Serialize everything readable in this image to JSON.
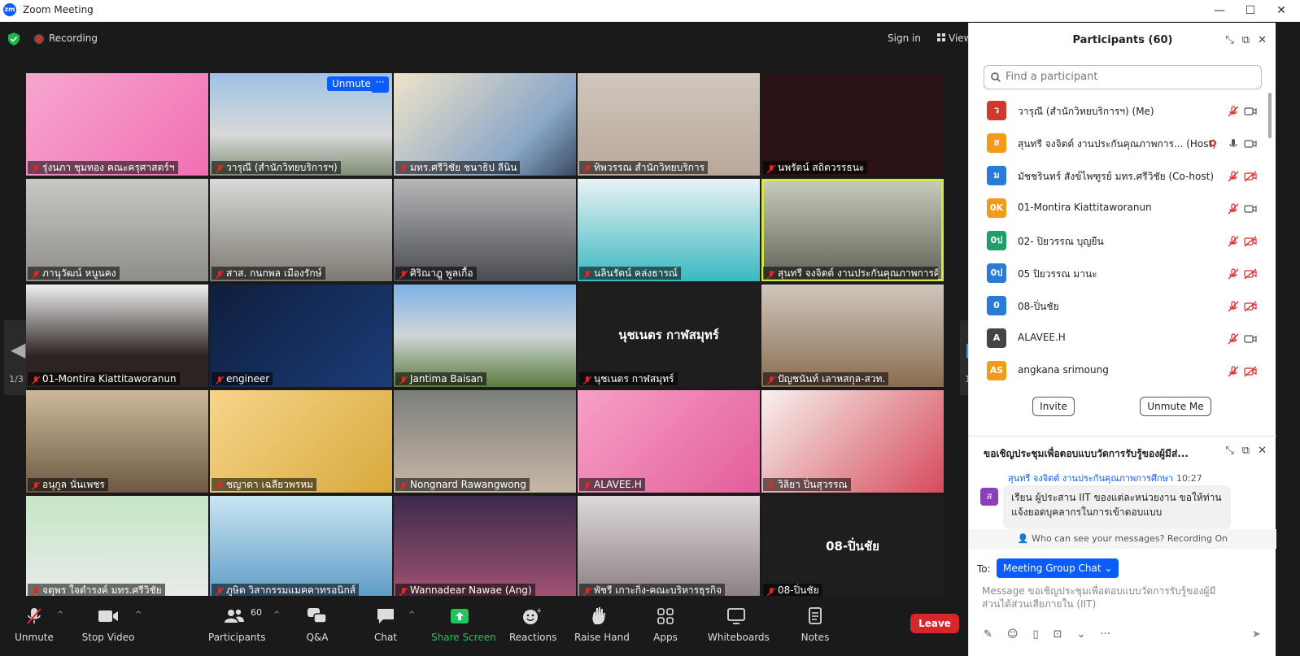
{
  "window": {
    "title": "Zoom Meeting",
    "logo": "zm",
    "minimize": "—",
    "maximize": "☐",
    "close": "✕"
  },
  "topbar": {
    "recording": "Recording",
    "signin": "Sign in",
    "view": "View"
  },
  "tile_overlay": {
    "unmute": "Unmute",
    "more": "···"
  },
  "nav": {
    "page_left": "1/3",
    "page_right": "1/3",
    "left_arrow": "◀",
    "right_arrow": "▶"
  },
  "tiles": [
    {
      "name": "รุ่งนภา ชุมทอง คณะครุศาสตร์ฯ",
      "bg": "linear-gradient(135deg,#f7a6cf,#f06fb3)"
    },
    {
      "name": "วารุณี (สำนักวิทยบริการฯ)",
      "bg": "linear-gradient(180deg,#9fc1e6,#d9d9d9 60%,#7f8e77)"
    },
    {
      "name": "มทร.ศรีวิชัย ชนาธิป ลีนิน",
      "bg": "linear-gradient(135deg,#efe3c9,#8aa7c8 70%,#394b63)"
    },
    {
      "name": "ทิพวรรณ สำนักวิทยบริการ",
      "bg": "linear-gradient(180deg,#cfc7bd,#b9a89a)"
    },
    {
      "name": "นพรัตน์ สถิตวรรธนะ",
      "bg": "#2a1216"
    },
    {
      "name": "ภานุวัฒน์ หนูนคง",
      "bg": "linear-gradient(180deg,#c9c8c4,#8f8d88)"
    },
    {
      "name": "สาส. กนกพล เมืองรักษ์",
      "bg": "linear-gradient(180deg,#d9d9d7,#7e7a72)"
    },
    {
      "name": "ศิริณาฎู พูลเกื้อ",
      "bg": "linear-gradient(180deg,#b5b7b9,#4a4b4f)"
    },
    {
      "name": "นลินรัตน์ คล่งธารณ์",
      "bg": "linear-gradient(180deg,#e9f3f5,#3bb8c0)"
    },
    {
      "name": "สุนทรี จงจิตต์ งานประกันคุณภาพการศึกษา",
      "bg": "linear-gradient(180deg,#c9cdbd,#5f6255)"
    },
    {
      "name": "01-Montira Kiattitaworanun",
      "bg": "linear-gradient(180deg,#f0f0f0,#2d2320 70%)"
    },
    {
      "name": "engineer",
      "bg": "linear-gradient(135deg,#0e1e3d,#1c3c77)"
    },
    {
      "name": "Jantima Baisan",
      "bg": "linear-gradient(180deg,#7fb1e6,#cfd6d7 50%,#5a7b3e)"
    },
    {
      "name": "นุชเนตร กาฬสมุทร์",
      "bg": "#1e1e1e",
      "center": "นุชเนตร กาฬสมุทร์"
    },
    {
      "name": "ปัญชนันท์ เลาหสกุล-สวท.",
      "bg": "linear-gradient(180deg,#cfc7bd,#8a6c50)"
    },
    {
      "name": "อนุกูล นั่นเพชร",
      "bg": "linear-gradient(180deg,#cdb99a,#6e5a44)"
    },
    {
      "name": "ชญาดา เฉลียวพรหม",
      "bg": "linear-gradient(135deg,#f6d58a,#d8a93c)"
    },
    {
      "name": "Nongnard Rawangwong",
      "bg": "linear-gradient(180deg,#7a7f7a,#c8b7a8)"
    },
    {
      "name": "ALAVEE.H",
      "bg": "linear-gradient(135deg,#f6a1c6,#e35e99)"
    },
    {
      "name": "วิลิยา ปิ่นสุวรรณ",
      "bg": "linear-gradient(135deg,#f7f2ee,#d64a5b)"
    },
    {
      "name": "จตุพร ใจดำรงค์ มทร.ศรีวิชัย",
      "bg": "linear-gradient(180deg,#c5e6c5,#eaeaea)"
    },
    {
      "name": "ภูษิต วิสากรรมแมคคาทรอนิกส์",
      "bg": "linear-gradient(180deg,#c9e6f4,#5e9bc4)"
    },
    {
      "name": "Wannadear Nawae (Ang)",
      "bg": "linear-gradient(180deg,#3c2a4d,#a25372)"
    },
    {
      "name": "พัชรี เกาะกิ่ง-คณะบริหารธุรกิจ",
      "bg": "linear-gradient(180deg,#ded8d8,#8b7f82)"
    },
    {
      "name": "08-ปิ่นชัย",
      "bg": "#1e1e1e",
      "center": "08-ปิ่นชัย"
    }
  ],
  "toolbar": {
    "unmute": "Unmute",
    "stop_video": "Stop Video",
    "participants": "Participants",
    "participants_count": "60",
    "qa": "Q&A",
    "chat": "Chat",
    "share": "Share Screen",
    "reactions": "Reactions",
    "raise_hand": "Raise Hand",
    "apps": "Apps",
    "whiteboards": "Whiteboards",
    "notes": "Notes",
    "leave": "Leave"
  },
  "participants_panel": {
    "title": "Participants (60)",
    "search_placeholder": "Find a participant",
    "invite": "Invite",
    "unmute_me": "Unmute Me",
    "items": [
      {
        "initials": "ว",
        "color": "#d03a2e",
        "name": "วารุณี (สำนักวิทยบริการฯ) (Me)",
        "mic": "muted",
        "cam": "on"
      },
      {
        "initials": "ส",
        "color": "#f29a1a",
        "name": "สุนทรี จงจิตต์ งานประกันคุณภาพการ... (Host)",
        "mic": "on",
        "cam": "on",
        "rec": true
      },
      {
        "initials": "ม",
        "color": "#2a7bd6",
        "name": "มัชชรินทร์ สังข์ไพฑูรย์ มทร.ศรีวิชัย (Co-host)",
        "mic": "muted",
        "cam": "off"
      },
      {
        "initials": "0K",
        "color": "#f29a1a",
        "name": "01-Montira Kiattitaworanun",
        "mic": "muted",
        "cam": "on"
      },
      {
        "initials": "0ป",
        "color": "#1f9e68",
        "name": "02- ปิยวรรณ บุญยืน",
        "mic": "muted",
        "cam": "off"
      },
      {
        "initials": "0ป",
        "color": "#2a7bd6",
        "name": "05 ปิยวรรณ มานะ",
        "mic": "muted",
        "cam": "off"
      },
      {
        "initials": "0",
        "color": "#2a7bd6",
        "name": "08-ปิ่นชัย",
        "mic": "muted",
        "cam": "off"
      },
      {
        "initials": "A",
        "color": "#444444",
        "name": "ALAVEE.H",
        "mic": "muted",
        "cam": "on"
      },
      {
        "initials": "AS",
        "color": "#f29a1a",
        "name": "angkana srimoung",
        "mic": "muted",
        "cam": "off"
      }
    ]
  },
  "chat_panel": {
    "title": "ขอเชิญประชุมเพื่อตอบแบบวัดการรับรู้ของผู้มีส่...",
    "sender": "สุนทรี จงจิตต์ งานประกันคุณภาพการศึกษา",
    "time": "10:27",
    "avatar": "ส",
    "message": "เรียน ผู้ประสาน IIT ของแต่ละหน่วยงาน ขอให้ท่านแจ้งยอดบุคลากรในการเข้าตอบแบบ",
    "who_can_see": "Who can see your messages? Recording On",
    "to_label": "To:",
    "to_value": "Meeting Group Chat ⌄",
    "input_placeholder": "Message ขอเชิญประชุมเพื่อตอบแบบวัดการรับรู้ของผู้มีส่วนได้ส่วนเสียภายใน (IIT)",
    "tools": [
      "format-icon",
      "emoji-icon",
      "file-icon",
      "screenshot-icon",
      "more-icon"
    ],
    "more_caret": "⌄",
    "more_dots": "···"
  },
  "colors": {
    "accent": "#0b5cff",
    "leave": "#d6282a",
    "share": "#21c55d",
    "active_speaker": "#d6e646"
  }
}
